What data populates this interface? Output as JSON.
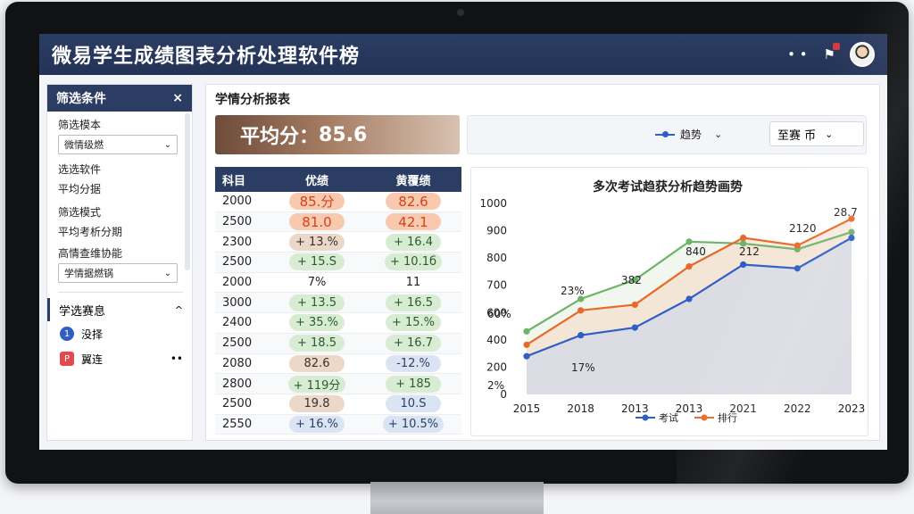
{
  "app": {
    "title": "微易学生成绩图表分析处理软件榜",
    "icons": [
      "more-icon",
      "notification-icon",
      "user-avatar"
    ]
  },
  "sidebar": {
    "header": "筛选条件",
    "close": "×",
    "labels": [
      "筛选模本",
      "选选软件",
      "平均分据",
      "筛选模式",
      "平均考析分期",
      "高情查维协能"
    ],
    "select1": "微情级燃",
    "select2": "学情据燃锅",
    "section": "学选赛息",
    "section_caret": "^",
    "items": [
      {
        "label": "没择",
        "icon": "1"
      },
      {
        "label": "翼连",
        "icon": "P",
        "more": "••"
      }
    ]
  },
  "main": {
    "title": "学情分析报表",
    "avg_label": "平均分：",
    "avg_value": "85.6",
    "legend_dropdown": "趋势",
    "dropdown_value": "至赛 币"
  },
  "table": {
    "headers": [
      "科目",
      "优绩",
      "黄覆绩"
    ],
    "rows": [
      {
        "c0": "2000",
        "c1": "85.分",
        "c2": "82.6",
        "s1": "orange",
        "s2": "orange"
      },
      {
        "c0": "2500",
        "c1": "81.0",
        "c2": "42.1",
        "s1": "orange",
        "s2": "orange"
      },
      {
        "c0": "2300",
        "c1": "+ 13.%",
        "c2": "+ 16.4",
        "s1": "tan",
        "s2": "green"
      },
      {
        "c0": "2500",
        "c1": "+ 15.S",
        "c2": "+ 10.1б",
        "s1": "green",
        "s2": "green"
      },
      {
        "c0": "2000",
        "c1": "7%",
        "c2": "11",
        "s1": "none",
        "s2": "none"
      },
      {
        "c0": "3000",
        "c1": "+ 13.5",
        "c2": "+ 16.5",
        "s1": "green",
        "s2": "green"
      },
      {
        "c0": "2400",
        "c1": "+ 35.%",
        "c2": "+ 15.%",
        "s1": "green",
        "s2": "green"
      },
      {
        "c0": "2500",
        "c1": "+ 18.5",
        "c2": "+ 16.7",
        "s1": "green",
        "s2": "green"
      },
      {
        "c0": "2080",
        "c1": "82.6",
        "c2": "-12.%",
        "s1": "tan",
        "s2": "blue"
      },
      {
        "c0": "2800",
        "c1": "+ 119分",
        "c2": "+ 185",
        "s1": "green",
        "s2": "green"
      },
      {
        "c0": "2500",
        "c1": "19.8",
        "c2": "10.S",
        "s1": "tan",
        "s2": "blue"
      },
      {
        "c0": "2550",
        "c1": "+ 16.%",
        "c2": "+ 10.5%",
        "s1": "blue",
        "s2": "blue"
      }
    ]
  },
  "chart_data": {
    "type": "line",
    "title": "多次考试趋获分析趋势画势",
    "x": [
      "2015",
      "2018",
      "2013",
      "2013",
      "2021",
      "2022",
      "2023"
    ],
    "yticks": [
      "1000",
      "900",
      "800",
      "700",
      "600",
      "400",
      "200",
      "0"
    ],
    "ylim": [
      0,
      1000
    ],
    "series": [
      {
        "name": "考试",
        "color": "#2f5ec4",
        "values": [
          200,
          310,
          350,
          500,
          680,
          660,
          820
        ]
      },
      {
        "name": "排行",
        "color": "#e8692a",
        "values": [
          260,
          440,
          470,
          670,
          820,
          780,
          920
        ]
      },
      {
        "name": "",
        "color": "#6fb36a",
        "values": [
          330,
          500,
          600,
          800,
          790,
          760,
          850
        ]
      }
    ],
    "extra_series_values": [
      760,
      880,
      780
    ],
    "annotations": [
      "60%",
      "23%",
      "382",
      "840",
      "212",
      "2120",
      "28.7",
      "17%",
      "2%"
    ],
    "legend": [
      "考试",
      "排行"
    ]
  }
}
